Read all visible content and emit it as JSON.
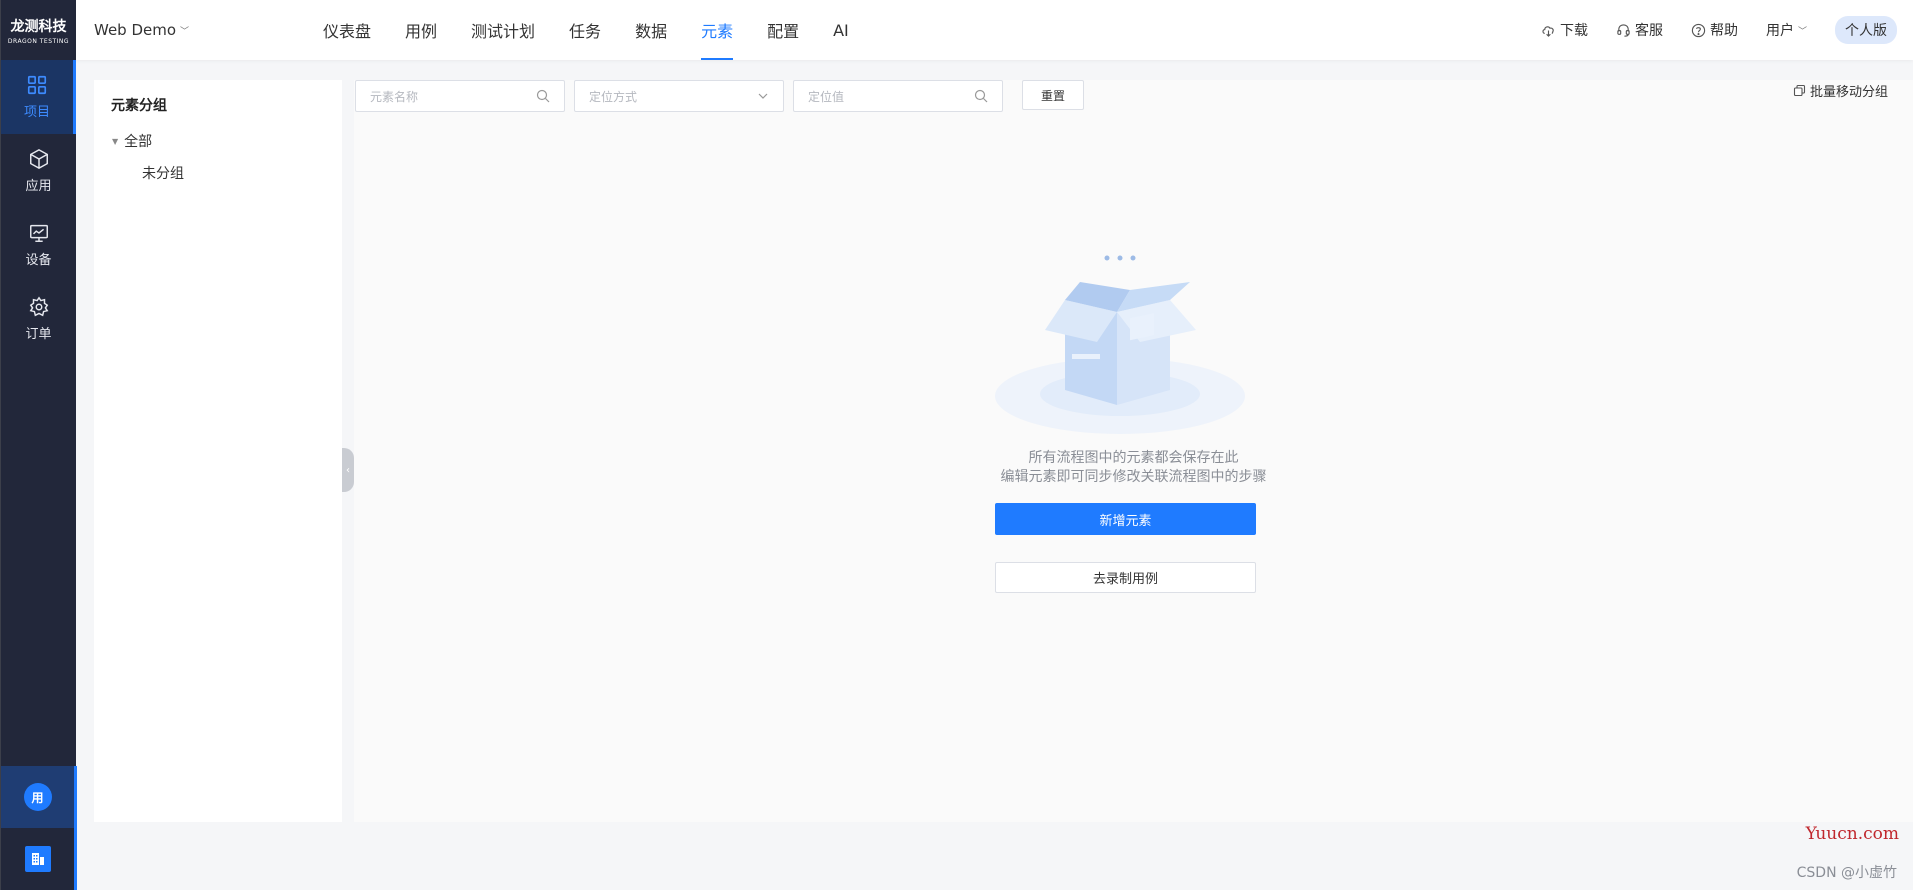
{
  "logo": {
    "cn": "龙测科技",
    "en": "DRAGON TESTING"
  },
  "sidebar": {
    "items": [
      {
        "label": "项目",
        "icon": "grid-icon",
        "active": true
      },
      {
        "label": "应用",
        "icon": "cube-icon",
        "active": false
      },
      {
        "label": "设备",
        "icon": "monitor-icon",
        "active": false
      },
      {
        "label": "订单",
        "icon": "gear-icon",
        "active": false
      }
    ],
    "user_avatar": "用",
    "org_icon": "building-icon"
  },
  "header": {
    "project_name": "Web Demo",
    "tabs": [
      {
        "label": "仪表盘",
        "active": false
      },
      {
        "label": "用例",
        "active": false
      },
      {
        "label": "测试计划",
        "active": false
      },
      {
        "label": "任务",
        "active": false
      },
      {
        "label": "数据",
        "active": false
      },
      {
        "label": "元素",
        "active": true
      },
      {
        "label": "配置",
        "active": false
      },
      {
        "label": "AI",
        "active": false
      }
    ],
    "download": "下载",
    "service": "客服",
    "help": "帮助",
    "user": "用户",
    "edition": "个人版"
  },
  "groups": {
    "title": "元素分组",
    "root": "全部",
    "child": "未分组"
  },
  "filters": {
    "name_placeholder": "元素名称",
    "method_placeholder": "定位方式",
    "value_placeholder": "定位值",
    "reset": "重置",
    "batch_move": "批量移动分组"
  },
  "empty": {
    "line1": "所有流程图中的元素都会保存在此",
    "line2": "编辑元素即可同步修改关联流程图中的步骤",
    "add_button": "新增元素",
    "record_button": "去录制用例"
  },
  "watermark": {
    "site": "Yuucn.com",
    "credit": "CSDN @小虚竹"
  },
  "colors": {
    "accent": "#1f7bff",
    "sidebar_bg": "#22273a"
  }
}
